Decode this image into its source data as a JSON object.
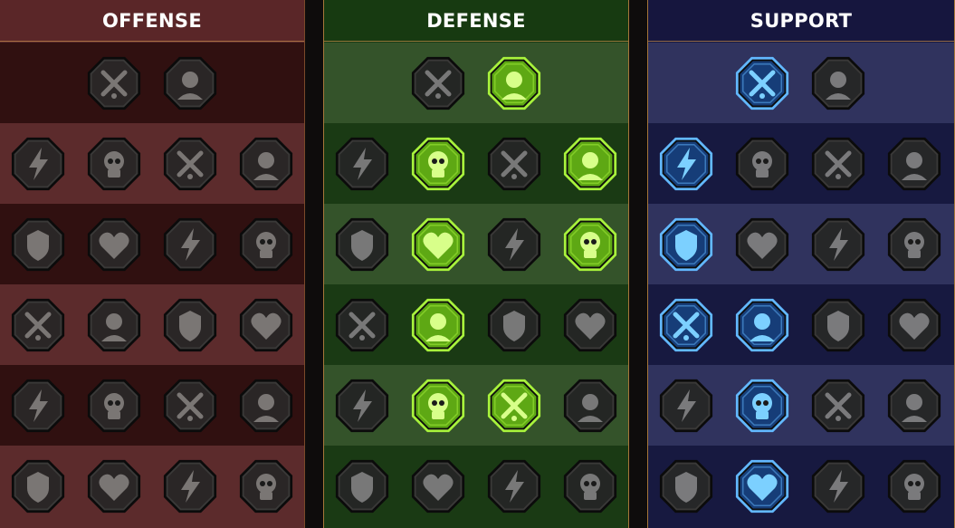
{
  "panels": [
    {
      "id": "offense",
      "title": "OFFENSE",
      "colors": {
        "header": "#5a2628",
        "row_a": "#301010",
        "row_b": "#5c2b2c",
        "octagon": "#2a2626",
        "glyph": "#7a7674"
      },
      "rows": [
        {
          "nodes": [
            {
              "icon": "crossed-swords-icon",
              "active": false
            },
            {
              "icon": "claw-slash-icon",
              "active": false
            }
          ]
        },
        {
          "nodes": [
            {
              "icon": "horned-demon-icon",
              "active": false
            },
            {
              "icon": "sword-slash-icon",
              "active": false
            },
            {
              "icon": "piercing-shield-icon",
              "active": false
            },
            {
              "icon": "bleeding-heart-icon",
              "active": false
            }
          ]
        },
        {
          "nodes": [
            {
              "icon": "arrow-strike-icon",
              "active": false
            },
            {
              "icon": "fanged-jaws-icon",
              "active": false
            },
            {
              "icon": "skull-slash-icon",
              "active": false
            },
            {
              "icon": "dagger-hand-icon",
              "active": false
            }
          ]
        },
        {
          "nodes": [
            {
              "icon": "melting-sword-icon",
              "active": false
            },
            {
              "icon": "fist-hammer-icon",
              "active": false
            },
            {
              "icon": "axe-icon",
              "active": false
            },
            {
              "icon": "lightning-chain-icon",
              "active": false
            }
          ]
        },
        {
          "nodes": [
            {
              "icon": "crossed-blades-icon",
              "active": false
            },
            {
              "icon": "skull-crowd-icon",
              "active": false
            },
            {
              "icon": "sword-circle-icon",
              "active": false
            },
            {
              "icon": "electric-figure-icon",
              "active": false
            }
          ]
        },
        {
          "nodes": [
            {
              "icon": "sparkling-sword-icon",
              "active": false
            },
            {
              "icon": "knight-helmet-icon",
              "active": false
            },
            {
              "icon": "beast-icon",
              "active": false
            },
            {
              "icon": "spiked-skull-icon",
              "active": false
            }
          ]
        }
      ]
    },
    {
      "id": "defense",
      "title": "DEFENSE",
      "colors": {
        "header": "#173a11",
        "row_a": "#34532a",
        "row_b": "#1a3a14",
        "octagon": "#242624",
        "glyph": "#787878",
        "active_fill": "#5ea814",
        "active_glyph": "#d8ff8a",
        "active_border": "#a8f23c"
      },
      "rows": [
        {
          "nodes": [
            {
              "icon": "brick-wall-icon",
              "active": false
            },
            {
              "icon": "raised-fist-icon",
              "active": true
            }
          ]
        },
        {
          "nodes": [
            {
              "icon": "layered-shield-icon",
              "active": false
            },
            {
              "icon": "anatomical-heart-icon",
              "active": true
            },
            {
              "icon": "stone-golem-icon",
              "active": false
            },
            {
              "icon": "crossed-feathers-icon",
              "active": true
            }
          ]
        },
        {
          "nodes": [
            {
              "icon": "dodging-figure-icon",
              "active": false
            },
            {
              "icon": "knight-shield-icon",
              "active": true
            },
            {
              "icon": "heart-skull-icon",
              "active": false
            },
            {
              "icon": "hooded-figure-icon",
              "active": true
            }
          ]
        },
        {
          "nodes": [
            {
              "icon": "crowd-icon",
              "active": false
            },
            {
              "icon": "alien-radiant-icon",
              "active": true
            },
            {
              "icon": "open-hand-icon",
              "active": false
            },
            {
              "icon": "bull-head-icon",
              "active": false
            }
          ]
        },
        {
          "nodes": [
            {
              "icon": "speed-runner-icon",
              "active": false
            },
            {
              "icon": "green-flames-icon",
              "active": true
            },
            {
              "icon": "radiant-skull-icon",
              "active": true
            },
            {
              "icon": "swoosh-hand-icon",
              "active": false
            }
          ]
        },
        {
          "nodes": [
            {
              "icon": "spiky-warrior-icon",
              "active": false
            },
            {
              "icon": "winged-shield-icon",
              "active": false
            },
            {
              "icon": "bearded-face-icon",
              "active": false
            },
            {
              "icon": "flexing-figure-icon",
              "active": false
            }
          ]
        }
      ]
    },
    {
      "id": "support",
      "title": "SUPPORT",
      "colors": {
        "header": "#16163e",
        "row_a": "#30335e",
        "row_b": "#171940",
        "octagon": "#262728",
        "glyph": "#7a7a7c",
        "active_fill": "#163d78",
        "active_glyph": "#7cd0ff",
        "active_border": "#62b8ff"
      },
      "rows": [
        {
          "nodes": [
            {
              "icon": "heart-plus-icon",
              "active": true
            },
            {
              "icon": "spiral-hand-icon",
              "active": false
            }
          ]
        },
        {
          "nodes": [
            {
              "icon": "praying-hands-icon",
              "active": true
            },
            {
              "icon": "dome-shield-icon",
              "active": false
            },
            {
              "icon": "flaming-skull-icon",
              "active": false
            },
            {
              "icon": "speed-arm-icon",
              "active": false
            }
          ]
        },
        {
          "nodes": [
            {
              "icon": "sparkle-figure-icon",
              "active": true
            },
            {
              "icon": "lightning-bolt-icon",
              "active": false
            },
            {
              "icon": "zigzag-lightning-icon",
              "active": false
            },
            {
              "icon": "shadow-figure-icon",
              "active": false
            }
          ]
        },
        {
          "nodes": [
            {
              "icon": "chained-heart-icon",
              "active": true
            },
            {
              "icon": "meteor-icon",
              "active": true
            },
            {
              "icon": "open-book-icon",
              "active": false
            },
            {
              "icon": "angry-eyes-icon",
              "active": false
            }
          ]
        },
        {
          "nodes": [
            {
              "icon": "compass-star-icon",
              "active": false
            },
            {
              "icon": "speed-boot-icon",
              "active": true
            },
            {
              "icon": "all-seeing-eye-icon",
              "active": false
            },
            {
              "icon": "voodoo-doll-icon",
              "active": false
            }
          ]
        },
        {
          "nodes": [
            {
              "icon": "poison-flask-icon",
              "active": false
            },
            {
              "icon": "skull-crossbones-icon",
              "active": true
            },
            {
              "icon": "fist-crowd-icon",
              "active": false
            },
            {
              "icon": "eagle-icon",
              "active": false
            }
          ]
        }
      ]
    }
  ]
}
